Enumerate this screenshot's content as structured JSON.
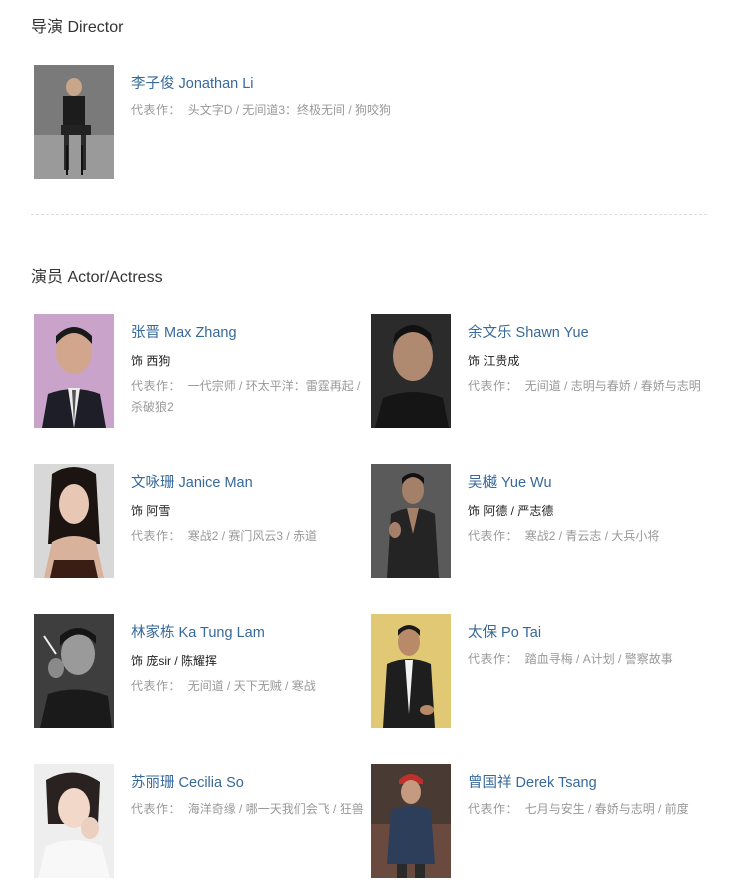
{
  "sections": {
    "director_title": "导演 Director",
    "cast_title": "演员 Actor/Actress"
  },
  "director": {
    "name": "李子俊 Jonathan Li",
    "works_label": "代表作：",
    "works": "头文字D / 无间道3：终极无间 / 狗咬狗"
  },
  "cast": [
    {
      "name": "张晋 Max Zhang",
      "role": "饰 西狗",
      "works_label": "代表作：",
      "works": "一代宗师 / 环太平洋：雷霆再起 / 杀破狼2"
    },
    {
      "name": "余文乐 Shawn Yue",
      "role": "饰 江贵成",
      "works_label": "代表作：",
      "works": "无间道 / 志明与春娇 / 春娇与志明"
    },
    {
      "name": "文咏珊 Janice Man",
      "role": "饰 阿雪",
      "works_label": "代表作：",
      "works": "寒战2 / 赛门风云3 / 赤道"
    },
    {
      "name": "吴樾 Yue Wu",
      "role": "饰 阿德 / 严志德",
      "works_label": "代表作：",
      "works": "寒战2 / 青云志 / 大兵小将"
    },
    {
      "name": "林家栋 Ka Tung Lam",
      "role": "饰 庞sir / 陈耀挥",
      "works_label": "代表作：",
      "works": "无间道 / 天下无贼 / 寒战"
    },
    {
      "name": "太保 Po Tai",
      "role": "",
      "works_label": "代表作：",
      "works": "踏血寻梅 / A计划 / 警察故事"
    },
    {
      "name": "苏丽珊 Cecilia So",
      "role": "",
      "works_label": "代表作：",
      "works": "海洋奇缘 / 哪一天我们会飞 / 狂兽"
    },
    {
      "name": "曾国祥 Derek Tsang",
      "role": "",
      "works_label": "代表作：",
      "works": "七月与安生 / 春娇与志明 / 前度"
    }
  ],
  "colors": {
    "name_link": "#37699a",
    "works_text": "#999999",
    "role_text": "#222222",
    "title_text": "#333333"
  }
}
